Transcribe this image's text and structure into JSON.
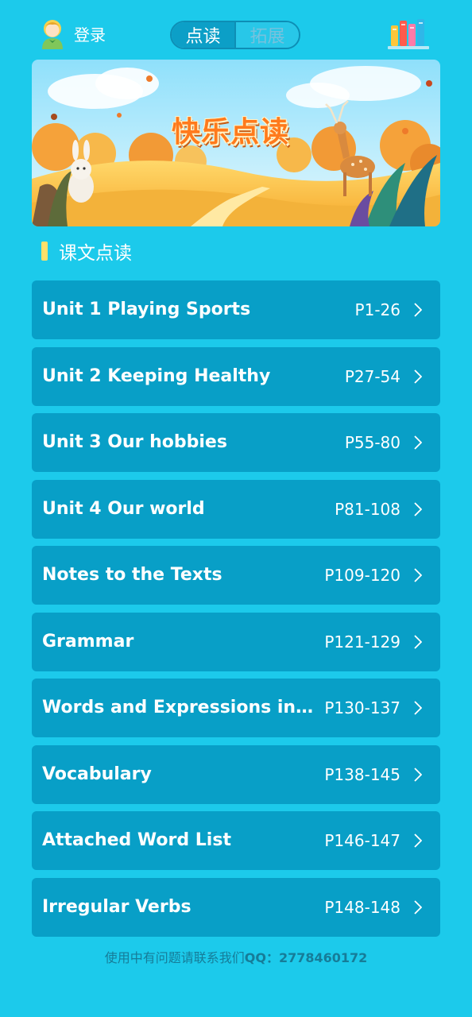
{
  "header": {
    "login_label": "登录",
    "tabs": [
      {
        "label": "点读",
        "active": true
      },
      {
        "label": "拓展",
        "active": false
      }
    ]
  },
  "banner": {
    "title": "快乐点读"
  },
  "section": {
    "title": "课文点读"
  },
  "units": [
    {
      "title": "Unit 1 Playing Sports",
      "pages": "P1-26"
    },
    {
      "title": "Unit 2 Keeping Healthy",
      "pages": "P27-54"
    },
    {
      "title": "Unit 3 Our hobbies",
      "pages": "P55-80"
    },
    {
      "title": "Unit 4 Our world",
      "pages": "P81-108"
    },
    {
      "title": "Notes to the Texts",
      "pages": "P109-120"
    },
    {
      "title": "Grammar",
      "pages": "P121-129"
    },
    {
      "title": "Words and Expressions in ...",
      "pages": "P130-137"
    },
    {
      "title": "Vocabulary",
      "pages": "P138-145"
    },
    {
      "title": "Attached Word List",
      "pages": "P146-147"
    },
    {
      "title": "Irregular Verbs",
      "pages": "P148-148"
    }
  ],
  "footer": {
    "prefix": "使用中有问题请联系我们",
    "contact": "QQ：2778460172"
  },
  "colors": {
    "background": "#1ccaeb",
    "list_item": "#089fc7",
    "accent_bar": "#ffe06a"
  }
}
